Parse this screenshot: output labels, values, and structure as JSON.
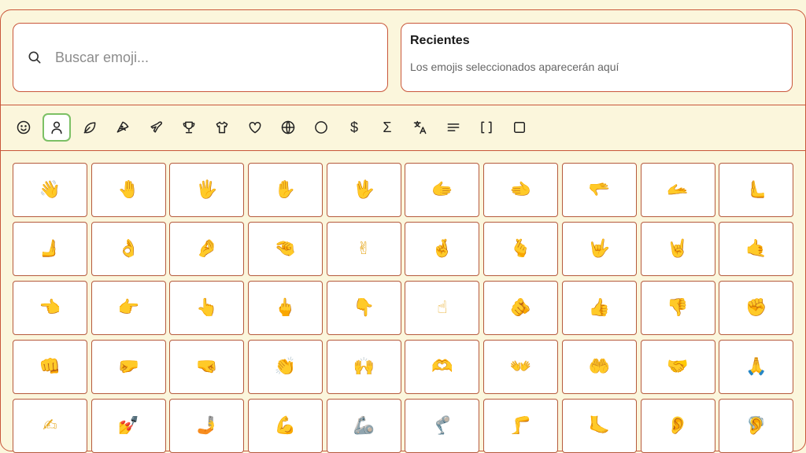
{
  "search": {
    "placeholder": "Buscar emoji..."
  },
  "recent": {
    "title": "Recientes",
    "subtitle": "Los emojis seleccionados aparecerán aquí"
  },
  "categories": [
    {
      "name": "smileys-icon",
      "active": false
    },
    {
      "name": "people-icon",
      "active": true
    },
    {
      "name": "nature-leaf-icon",
      "active": false
    },
    {
      "name": "food-pizza-icon",
      "active": false
    },
    {
      "name": "travel-plane-icon",
      "active": false
    },
    {
      "name": "activities-trophy-icon",
      "active": false
    },
    {
      "name": "objects-shirt-icon",
      "active": false
    },
    {
      "name": "symbols-heart-icon",
      "active": false
    },
    {
      "name": "flags-globe-icon",
      "active": false
    },
    {
      "name": "circle-icon",
      "active": false
    },
    {
      "name": "currency-dollar-icon",
      "active": false,
      "glyph": "$"
    },
    {
      "name": "math-sigma-icon",
      "active": false,
      "glyph": "Σ"
    },
    {
      "name": "translate-icon",
      "active": false
    },
    {
      "name": "text-lines-icon",
      "active": false
    },
    {
      "name": "brackets-icon",
      "active": false,
      "glyph": "[ ]"
    },
    {
      "name": "square-icon",
      "active": false
    }
  ],
  "emojis": [
    "👋",
    "🤚",
    "🖐",
    "✋",
    "🖖",
    "🫱",
    "🫲",
    "🫳",
    "🫴",
    "🫷",
    "🫸",
    "👌",
    "🤌",
    "🤏",
    "✌",
    "🤞",
    "🫰",
    "🤟",
    "🤘",
    "🤙",
    "👈",
    "👉",
    "👆",
    "🖕",
    "👇",
    "☝",
    "🫵",
    "👍",
    "👎",
    "✊",
    "👊",
    "🤛",
    "🤜",
    "👏",
    "🙌",
    "🫶",
    "👐",
    "🤲",
    "🤝",
    "🙏",
    "✍",
    "💅",
    "🤳",
    "💪",
    "🦾",
    "🦿",
    "🦵",
    "🦶",
    "👂",
    "🦻"
  ]
}
